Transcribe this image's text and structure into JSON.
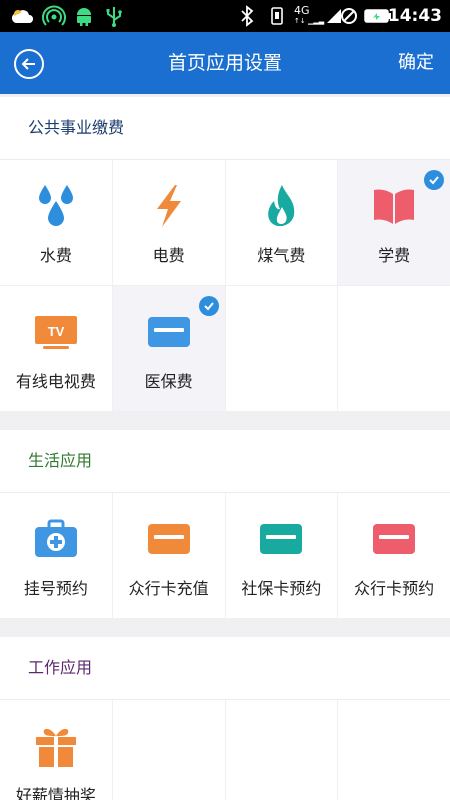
{
  "status_bar": {
    "time": "14:43",
    "network": "4G",
    "icons": [
      "cloud-icon",
      "signal-waves-icon",
      "android-icon",
      "usb-icon",
      "bluetooth-icon",
      "vibrate-icon",
      "4g-signal-icon",
      "no-sim-icon",
      "battery-charging-icon"
    ]
  },
  "header": {
    "title": "首页应用设置",
    "confirm_label": "确定",
    "color": "#1a6fd0"
  },
  "sections": [
    {
      "title": "公共事业缴费",
      "title_color": "#1b3d6e",
      "items": [
        {
          "label": "水费",
          "icon": "water-drops-icon",
          "color": "#2e8ede",
          "selected": false
        },
        {
          "label": "电费",
          "icon": "lightning-icon",
          "color": "#f08a3a",
          "selected": false
        },
        {
          "label": "煤气费",
          "icon": "flame-icon",
          "color": "#18a9a0",
          "selected": false
        },
        {
          "label": "学费",
          "icon": "book-icon",
          "color": "#ee5d6c",
          "selected": true
        },
        {
          "label": "有线电视费",
          "icon": "tv-icon",
          "color": "#f08a3a",
          "selected": false
        },
        {
          "label": "医保费",
          "icon": "card-icon",
          "color": "#3f97e4",
          "selected": true
        }
      ]
    },
    {
      "title": "生活应用",
      "title_color": "#2e7a2e",
      "items": [
        {
          "label": "挂号预约",
          "icon": "medical-kit-icon",
          "color": "#3f97e4",
          "selected": false
        },
        {
          "label": "众行卡充值",
          "icon": "card-icon",
          "color": "#f08a3a",
          "selected": false
        },
        {
          "label": "社保卡预约",
          "icon": "card-icon",
          "color": "#18a9a0",
          "selected": false
        },
        {
          "label": "众行卡预约",
          "icon": "card-icon",
          "color": "#ee5d6c",
          "selected": false
        }
      ]
    },
    {
      "title": "工作应用",
      "title_color": "#5b2a6e",
      "items": [
        {
          "label": "好薪情抽奖",
          "icon": "gift-icon",
          "color": "#f08a3a",
          "selected": false
        }
      ]
    }
  ]
}
